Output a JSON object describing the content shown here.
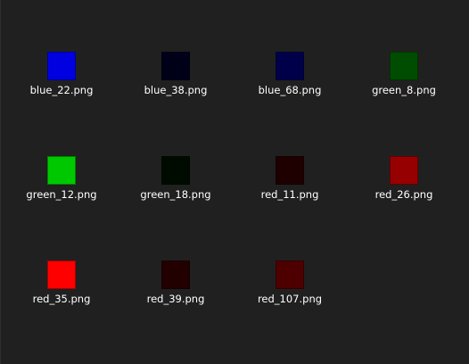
{
  "files": [
    {
      "name": "blue_22.png",
      "color": "#0000e0"
    },
    {
      "name": "blue_38.png",
      "color": "#000018"
    },
    {
      "name": "blue_68.png",
      "color": "#00004a"
    },
    {
      "name": "green_8.png",
      "color": "#004c00"
    },
    {
      "name": "green_12.png",
      "color": "#00c800"
    },
    {
      "name": "green_18.png",
      "color": "#000b00"
    },
    {
      "name": "red_11.png",
      "color": "#1e0000"
    },
    {
      "name": "red_26.png",
      "color": "#960000"
    },
    {
      "name": "red_35.png",
      "color": "#ff0000"
    },
    {
      "name": "red_39.png",
      "color": "#230000"
    },
    {
      "name": "red_107.png",
      "color": "#4e0000"
    }
  ]
}
